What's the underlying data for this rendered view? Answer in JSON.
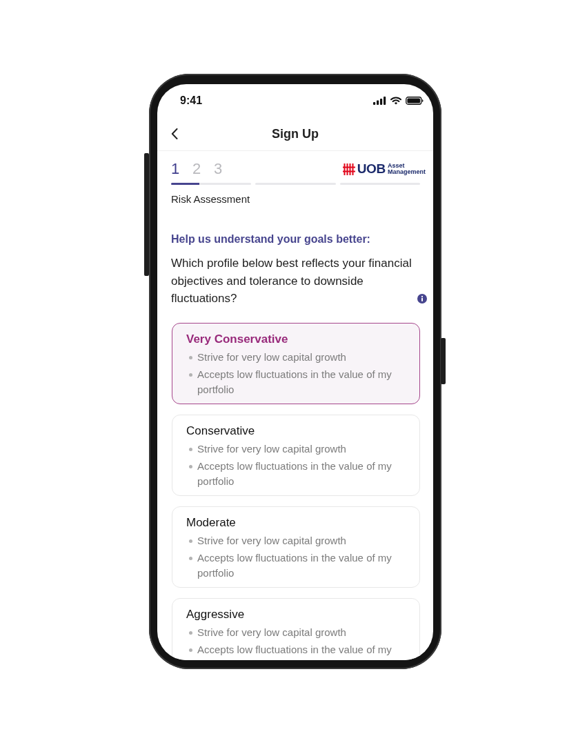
{
  "status_bar": {
    "time": "9:41"
  },
  "header": {
    "title": "Sign Up"
  },
  "stepper": {
    "steps": [
      {
        "label": "1",
        "selected": true,
        "level": 0.35
      },
      {
        "label": "2",
        "selected": false
      },
      {
        "label": "3",
        "selected": false
      }
    ],
    "step_title": "Risk Assessment"
  },
  "logo": {
    "name": "UOB",
    "subtitle": "Asset Management"
  },
  "question": {
    "heading": "Help us understand your goals better:",
    "text": "Which profile below best reflects your financial objectives and tolerance to downside fluctuations?"
  },
  "profiles": [
    {
      "title": "Very Conservative",
      "selected": true,
      "points": [
        "Strive for very low capital growth",
        "Accepts low fluctuations in the value of my portfolio"
      ]
    },
    {
      "title": "Conservative",
      "selected": false,
      "points": [
        "Strive for very low capital growth",
        "Accepts low fluctuations in the value of my portfolio"
      ]
    },
    {
      "title": "Moderate",
      "selected": false,
      "points": [
        "Strive for very low capital growth",
        "Accepts low fluctuations in the value of my portfolio"
      ]
    },
    {
      "title": "Aggressive",
      "selected": false,
      "points": [
        "Strive for very low capital growth",
        "Accepts low fluctuations in the value of my"
      ]
    }
  ]
}
